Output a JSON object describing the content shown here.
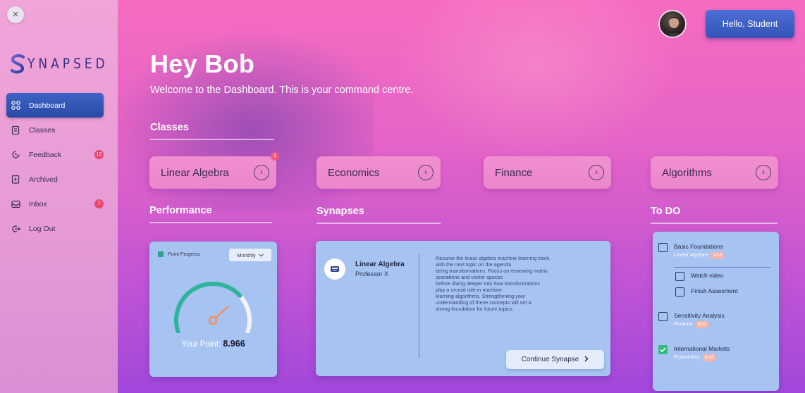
{
  "sidebar": {
    "close_icon": "×",
    "logo_text": "YNAPSED",
    "logo_letter": "S",
    "items": [
      {
        "label": "Dashboard",
        "icon": "grid-icon",
        "active": true,
        "badge": ""
      },
      {
        "label": "Classes",
        "icon": "clipboard-icon",
        "active": false,
        "badge": ""
      },
      {
        "label": "Feedback",
        "icon": "feedback-icon",
        "active": false,
        "badge": "12"
      },
      {
        "label": "Archived",
        "icon": "archive-icon",
        "active": false,
        "badge": ""
      },
      {
        "label": "Inbox",
        "icon": "inbox-icon",
        "active": false,
        "badge": "7"
      },
      {
        "label": "Log Out",
        "icon": "logout-icon",
        "active": false,
        "badge": ""
      }
    ]
  },
  "header": {
    "greeting_button": "Hello, Student",
    "title": "Hey Bob",
    "subtitle": "Welcome to the Dashboard. This is your command centre."
  },
  "classes": {
    "section_title": "Classes",
    "items": [
      {
        "label": "Linear Algebra",
        "badge": "1"
      },
      {
        "label": "Economics",
        "badge": ""
      },
      {
        "label": "Finance",
        "badge": ""
      },
      {
        "label": "Algorithms",
        "badge": ""
      }
    ],
    "chevron": "›"
  },
  "performance": {
    "section_title": "Performance",
    "legend": "Point Progress",
    "select_value": "Monthly",
    "points_label": "Your Point:",
    "points_value": "8.966",
    "progress_fraction": 0.72
  },
  "synapses": {
    "section_title": "Synapses",
    "course": "Linear Algebra",
    "professor": "Professor X",
    "description_lines": [
      "Resume the linear algebra machine learning track,",
      "with the next topic on the agenda",
      "being transformations. Focus on reviewing matrix",
      "operations and vector spaces",
      "before diving deeper into how transformations",
      "play a crucial role in machine",
      "learning algorithms. Strengthening your",
      "understanding of these concepts will set a",
      "strong foundation for future topics."
    ],
    "button": "Continue Synapse"
  },
  "todo": {
    "section_title": "To DO",
    "items": [
      {
        "title": "Basic Foundations",
        "subject": "Linear Algebra",
        "tag": "1/16",
        "checked": false
      },
      {
        "title": "Watch video",
        "subject": "",
        "tag": "",
        "checked": false
      },
      {
        "title": "Finish Assesment",
        "subject": "",
        "tag": "",
        "checked": false
      },
      {
        "title": "Sensitivity Analysis",
        "subject": "Finance",
        "tag": "6/13",
        "checked": false
      },
      {
        "title": "International Markets",
        "subject": "Economics",
        "tag": "8/15",
        "checked": true
      }
    ]
  },
  "colors": {
    "accent_blue": "#3d63c4",
    "gauge_teal": "#2fb39a",
    "gauge_needle": "#f0915c",
    "check_green": "#36b97d"
  }
}
